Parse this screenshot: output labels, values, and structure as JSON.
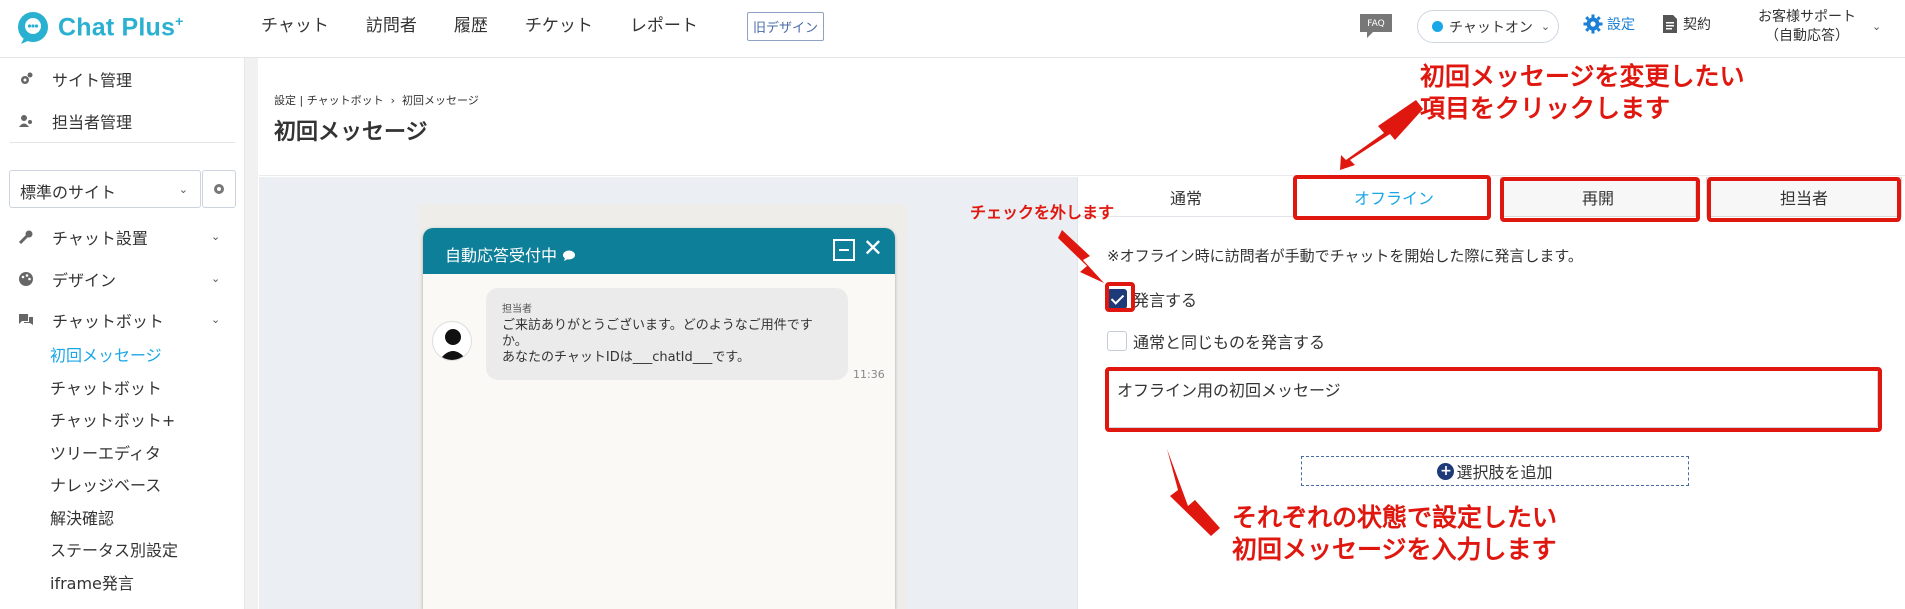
{
  "app": {
    "logo_text": "Chat Plus",
    "logo_sup": "+"
  },
  "nav": [
    "チャット",
    "訪問者",
    "履歴",
    "チケット",
    "レポート"
  ],
  "header": {
    "old_design": "旧デザイン",
    "faq": "FAQ",
    "chat_status": "チャットオン",
    "settings": "設定",
    "contract": "契約",
    "support_line1": "お客様サポート",
    "support_line2": "（自動応答）"
  },
  "sidebar": {
    "site_mgmt": "サイト管理",
    "staff_mgmt": "担当者管理",
    "site_select": "標準のサイト",
    "groups": {
      "chat_setup": "チャット設置",
      "design": "デザイン",
      "chatbot": "チャットボット"
    },
    "sub_items": [
      "初回メッセージ",
      "チャットボット",
      "チャットボット+",
      "ツリーエディタ",
      "ナレッジベース",
      "解決確認",
      "ステータス別設定",
      "iframe発言"
    ]
  },
  "breadcrumb": {
    "a": "設定",
    "sep1": "|",
    "b": "チャットボット",
    "sep2": "›",
    "c": "初回メッセージ"
  },
  "page_title": "初回メッセージ",
  "widget": {
    "title": "自動応答受付中",
    "sender": "担当者",
    "message": "ご来訪ありがとうございます。どのようなご用件ですか。\nあなたのチャットIDは___chatId___です。",
    "time": "11:36"
  },
  "tabs": [
    "通常",
    "オフライン",
    "再開",
    "担当者"
  ],
  "form": {
    "note": "※オフライン時に訪問者が手動でチャットを開始した際に発言します。",
    "speak_label": "発言する",
    "speak_checked": true,
    "same_label": "通常と同じものを発言する",
    "same_checked": false,
    "message_value": "オフライン用の初回メッセージ",
    "add_choice": "選択肢を追加"
  },
  "annotations": {
    "top_line1": "初回メッセージを変更したい",
    "top_line2": "項目をクリックします",
    "uncheck": "チェックを外します",
    "bottom_line1": "それぞれの状態で設定したい",
    "bottom_line2": "初回メッセージを入力します"
  },
  "colors": {
    "accent": "#1aa7e8",
    "widget_header": "#0e7f98",
    "annotation_red": "#e0170f",
    "checkbox_navy": "#1e3a78"
  }
}
